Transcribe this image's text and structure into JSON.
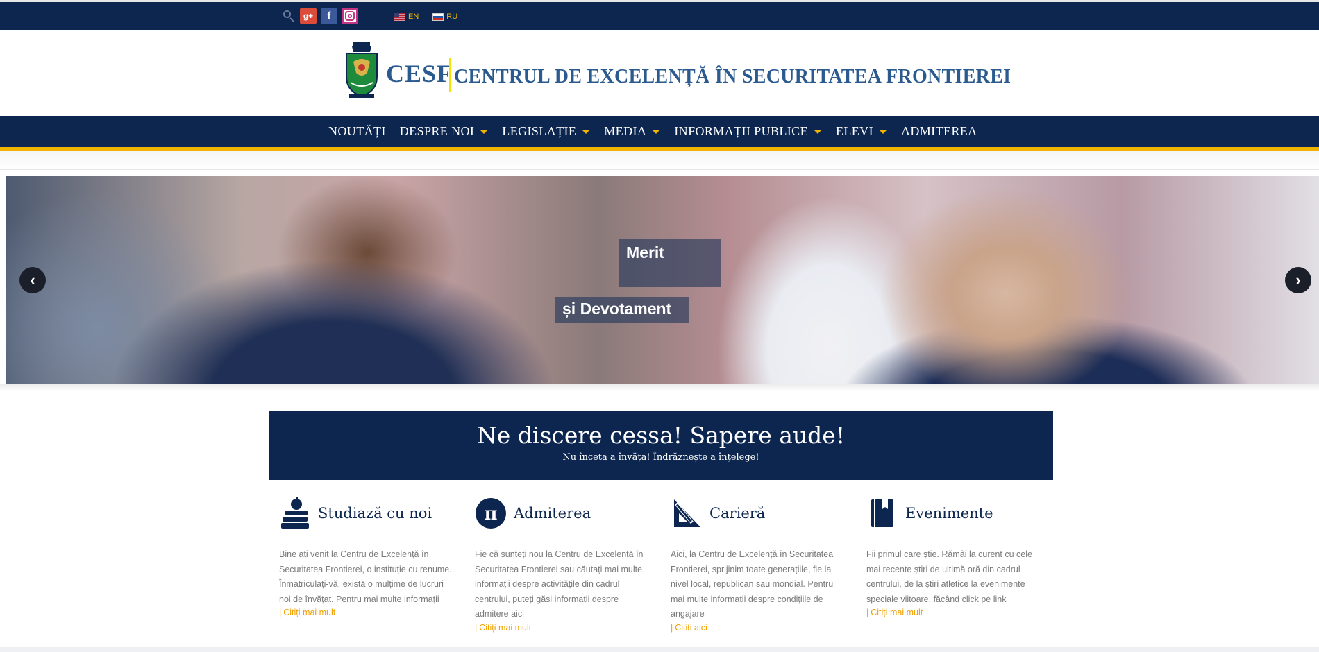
{
  "topbar": {
    "social": [
      {
        "name": "search-icon"
      },
      {
        "name": "google-plus-icon",
        "label": "g+"
      },
      {
        "name": "facebook-icon",
        "label": "f"
      },
      {
        "name": "instagram-icon"
      }
    ],
    "languages": [
      {
        "code": "EN",
        "flag": "us-flag-icon"
      },
      {
        "code": "RU",
        "flag": "ru-flag-icon"
      }
    ]
  },
  "header": {
    "short_name": "CESF",
    "full_name": "CENTRUL DE EXCELENȚĂ ÎN SECURITATEA FRONTIEREI"
  },
  "nav": {
    "items": [
      {
        "label": "NOUTĂȚI",
        "dropdown": false
      },
      {
        "label": "DESPRE NOI",
        "dropdown": true
      },
      {
        "label": "LEGISLAȚIE",
        "dropdown": true
      },
      {
        "label": "MEDIA",
        "dropdown": true
      },
      {
        "label": "INFORMAȚII PUBLICE",
        "dropdown": true
      },
      {
        "label": "ELEVI",
        "dropdown": true
      },
      {
        "label": "ADMITEREA",
        "dropdown": false
      }
    ]
  },
  "slider": {
    "caption_1": "Merit",
    "caption_2": "și Devotament",
    "prev_icon": "‹",
    "next_icon": "›"
  },
  "motto": {
    "title": "Ne discere cessa! Sapere aude!",
    "subtitle": "Nu înceta a învăța! Îndrăznește a înțelege!"
  },
  "columns": [
    {
      "icon": "apple-books-icon",
      "title": "Studiază cu noi",
      "text": "Bine ați venit la Centru de Excelență în Securitatea Frontierei, o instituție cu renume. Înmatriculați-vă, există o mulțime de lucruri noi de învățat. Pentru mai multe informații",
      "link": "Citiți mai mult"
    },
    {
      "icon": "pi-icon",
      "title": "Admiterea",
      "text": "Fie că sunteți nou la Centru de Excelență în Securitatea Frontierei sau căutați mai multe informații despre activitățile din cadrul centrului, puteți găsi informații despre admitere  aici",
      "link": "Citiți mai mult"
    },
    {
      "icon": "set-square-icon",
      "title": "Carieră",
      "text": "Aici, la Centru de Excelență în Securitatea Frontierei, sprijinim toate generațiile, fie la nivel local, republican sau mondial. Pentru mai multe informații despre condițiile de angajare",
      "link": "Citiți aici"
    },
    {
      "icon": "book-icon",
      "title": "Evenimente",
      "text": "Fii primul care știe. Rămâi la curent cu cele mai recente știri de ultimă oră din cadrul centrului, de la știri atletice la evenimente speciale viitoare, făcând click pe link",
      "link": "Citiți mai mult"
    }
  ]
}
